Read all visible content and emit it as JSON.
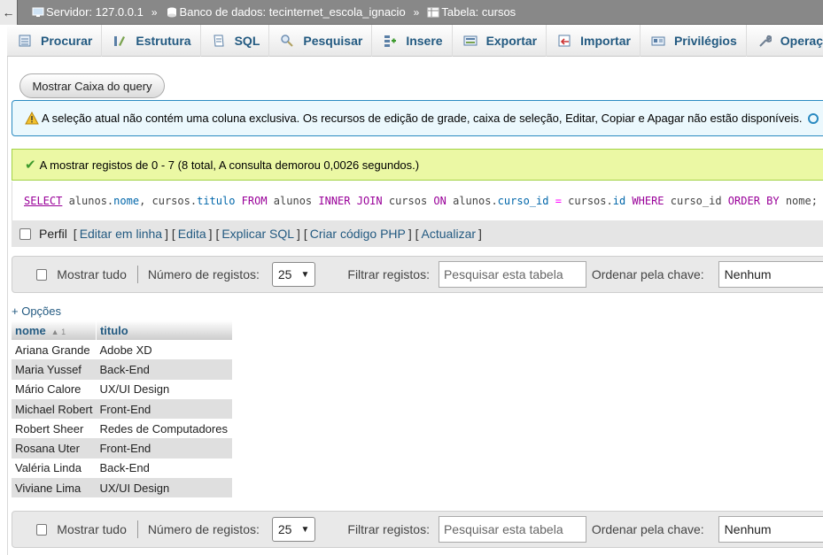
{
  "breadcrumb": {
    "back": "←",
    "server": "Servidor: 127.0.0.1",
    "database": "Banco de dados: tecinternet_escola_ignacio",
    "table": "Tabela: cursos",
    "separator": "»"
  },
  "tabs": [
    {
      "label": "Procurar",
      "icon": "browse-icon"
    },
    {
      "label": "Estrutura",
      "icon": "structure-icon"
    },
    {
      "label": "SQL",
      "icon": "sql-icon"
    },
    {
      "label": "Pesquisar",
      "icon": "search-icon"
    },
    {
      "label": "Insere",
      "icon": "insert-icon"
    },
    {
      "label": "Exportar",
      "icon": "export-icon"
    },
    {
      "label": "Importar",
      "icon": "import-icon"
    },
    {
      "label": "Privilégios",
      "icon": "privileges-icon"
    },
    {
      "label": "Operações",
      "icon": "operations-icon"
    }
  ],
  "query_box_button": "Mostrar Caixa do query",
  "notice": "A seleção atual não contém uma coluna exclusiva. Os recursos de edição de grade, caixa de seleção, Editar, Copiar e Apagar não estão disponíveis.",
  "success": "A mostrar registos de 0 - 7 (8 total, A consulta demorou 0,0026 segundos.)",
  "sql": {
    "select": "SELECT",
    "part1": " alunos.",
    "col1": "nome",
    "part2": ", cursos.",
    "col2": "titulo",
    "from": " FROM",
    "part3": " alunos ",
    "inner_join": "INNER JOIN",
    "part4": " cursos ",
    "on": "ON",
    "part5": " alunos.",
    "col3": "curso_id",
    "eq": " = ",
    "part6": "cursos.",
    "col4": "id",
    "where": " WHERE",
    "part7": " curso_id ",
    "order_by": "ORDER BY",
    "part8": " nome;"
  },
  "links_row": {
    "profile": "Perfil",
    "edit_inline": "Editar em linha",
    "edit": "Edita",
    "explain": "Explicar SQL",
    "create_php": "Criar código PHP",
    "refresh": "Actualizar"
  },
  "navigation": {
    "show_all": "Mostrar tudo",
    "rows_label": "Número de registos:",
    "rows_value": "25",
    "filter_label": "Filtrar registos:",
    "filter_placeholder": "Pesquisar esta tabela",
    "sort_label": "Ordenar pela chave:",
    "sort_value": "Nenhum"
  },
  "options_link": "+ Opções",
  "table": {
    "headers": [
      "nome",
      "titulo"
    ],
    "sort_indicator": "▲ 1",
    "rows": [
      [
        "Ariana Grande",
        "Adobe XD"
      ],
      [
        "Maria Yussef",
        "Back-End"
      ],
      [
        "Mário Calore",
        "UX/UI Design"
      ],
      [
        "Michael Robert",
        "Front-End"
      ],
      [
        "Robert Sheer",
        "Redes de Computadores"
      ],
      [
        "Rosana Uter",
        "Front-End"
      ],
      [
        "Valéria Linda",
        "Back-End"
      ],
      [
        "Viviane Lima",
        "UX/UI Design"
      ]
    ]
  }
}
